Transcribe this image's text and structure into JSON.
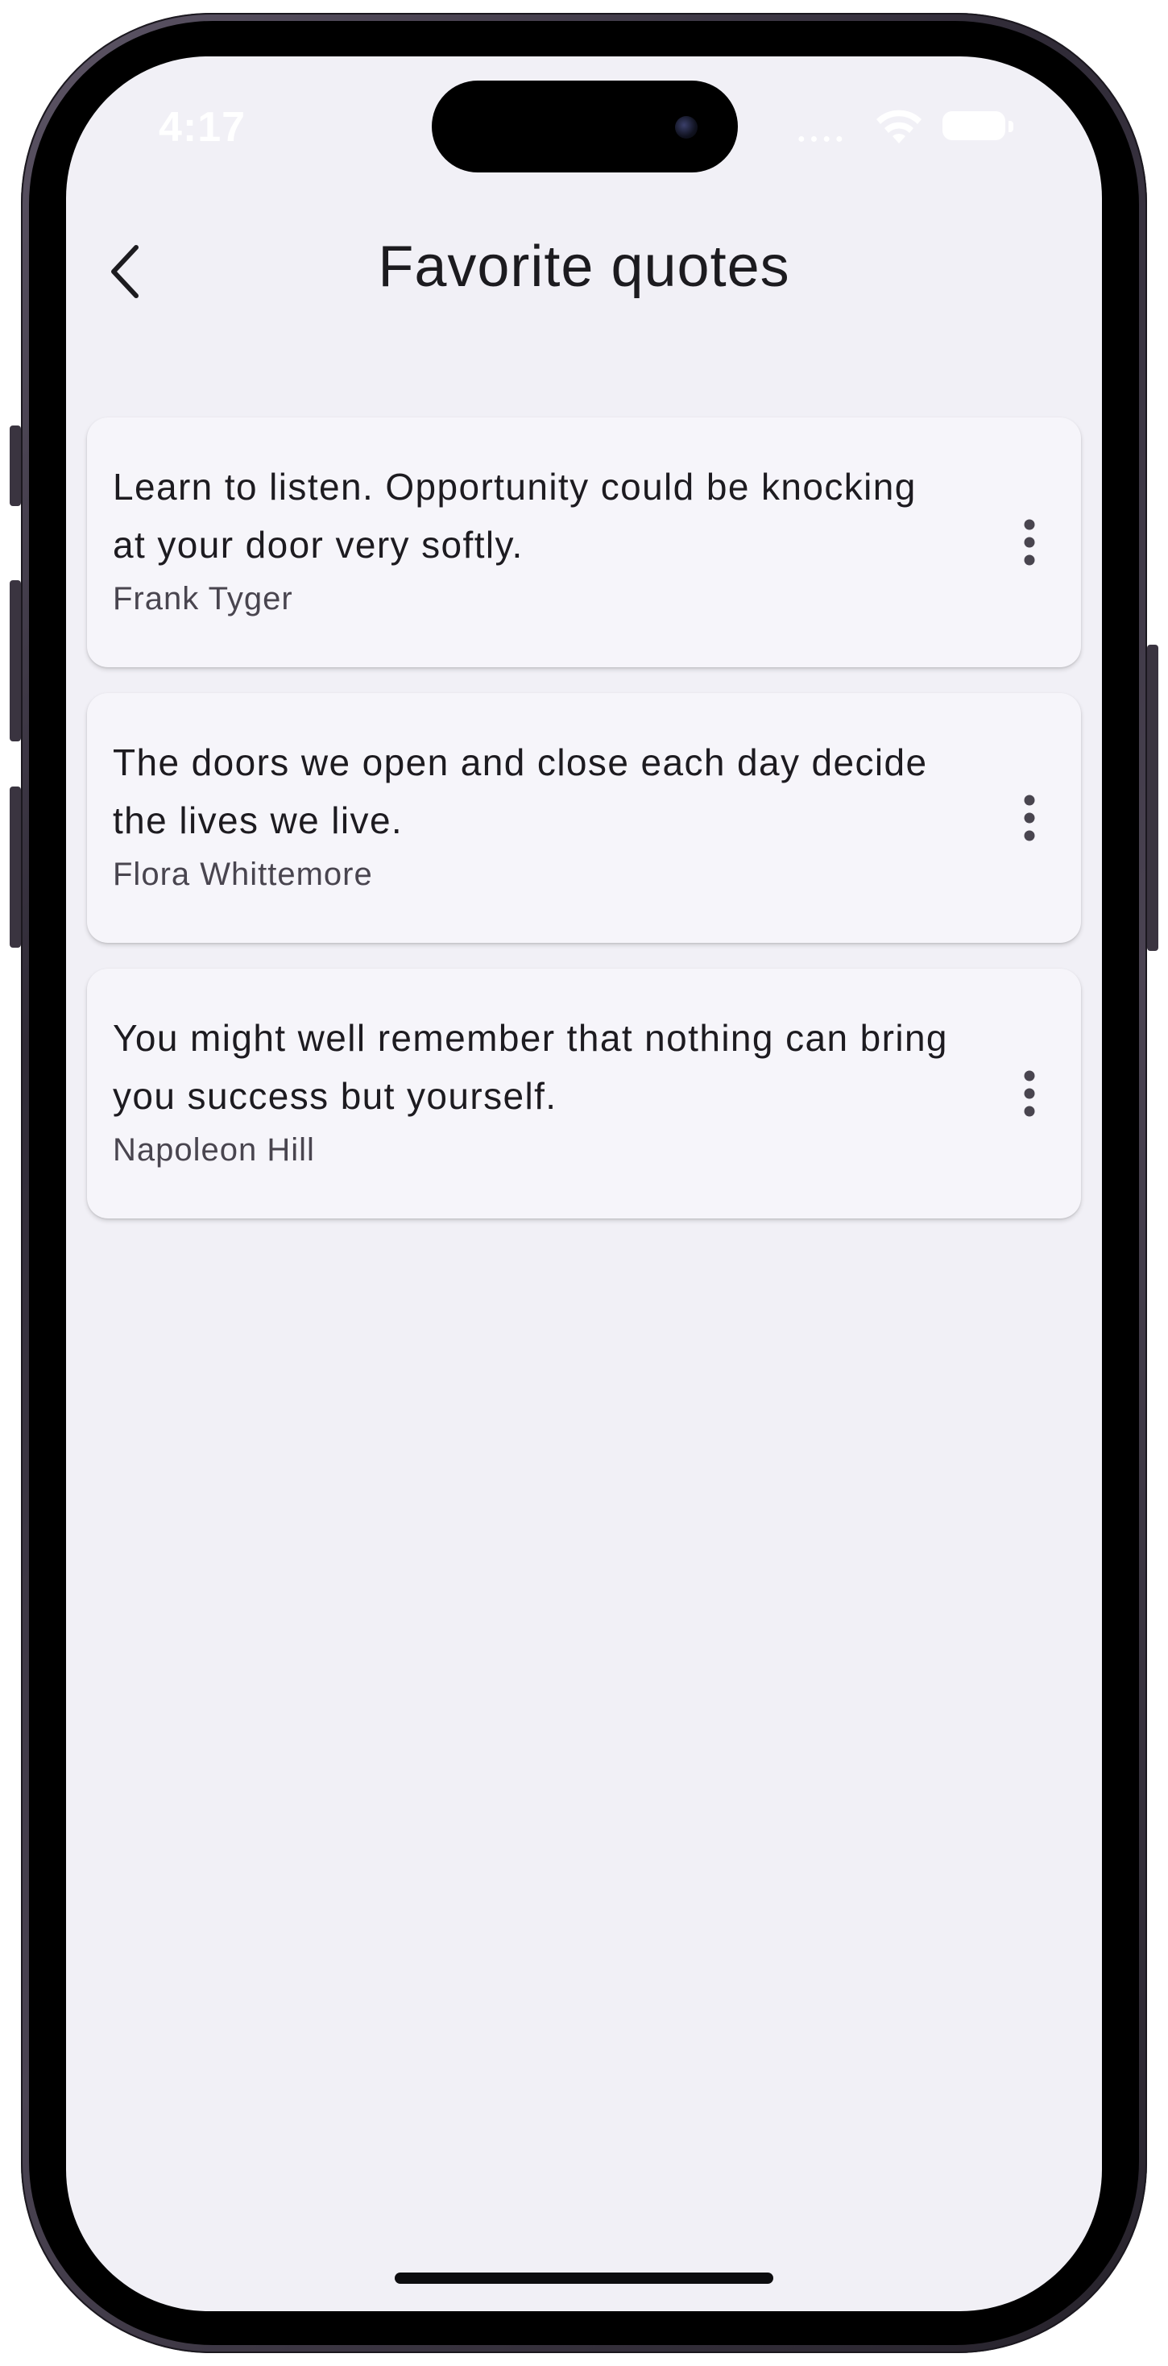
{
  "status_bar": {
    "time": "4:17"
  },
  "header": {
    "title": "Favorite quotes",
    "back_icon": "chevron-left-icon"
  },
  "quotes": [
    {
      "text": "Learn to listen. Opportunity could be knocking at your door very softly.",
      "author": "Frank Tyger"
    },
    {
      "text": "The doors we open and close each day decide the lives we live.",
      "author": "Flora Whittemore"
    },
    {
      "text": "You might well remember that nothing can bring you success but yourself.",
      "author": "Napoleon Hill"
    }
  ],
  "colors": {
    "background": "#f1f0f6",
    "card": "#f6f5fa",
    "text_primary": "#1d1b20",
    "text_secondary": "#49454f"
  }
}
